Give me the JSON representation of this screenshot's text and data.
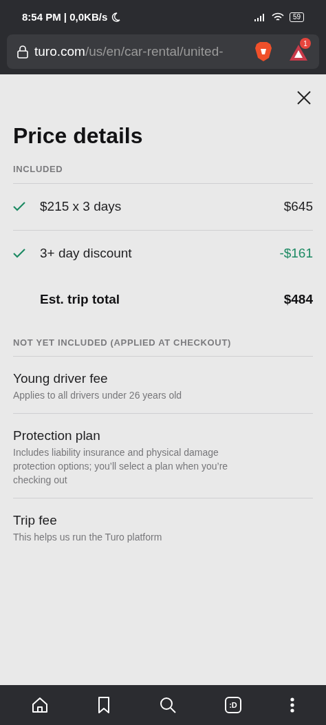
{
  "status_bar": {
    "time": "8:54 PM | 0,0KB/s",
    "battery": "59"
  },
  "browser": {
    "url_host": "turo.com",
    "url_path": "/us/en/car-rental/united-",
    "rewards_badge": "1",
    "tabs_label": ":D"
  },
  "title": "Price details",
  "included": {
    "heading": "INCLUDED",
    "items": [
      {
        "kind": "charge",
        "label": "$215 x 3 days",
        "amount": "$645"
      },
      {
        "kind": "discount",
        "label": "3+ day discount",
        "amount": "-$161"
      },
      {
        "kind": "total",
        "label": "Est. trip total",
        "amount": "$484"
      }
    ]
  },
  "not_included": {
    "heading": "NOT YET INCLUDED (APPLIED AT CHECKOUT)",
    "items": [
      {
        "label": "Young driver fee",
        "description": "Applies to all drivers under 26 years old"
      },
      {
        "label": "Protection plan",
        "description": "Includes liability insurance and physical damage protection options; you’ll select a plan when you’re checking out"
      },
      {
        "label": "Trip fee",
        "description": "This helps us run the Turo platform"
      }
    ]
  }
}
